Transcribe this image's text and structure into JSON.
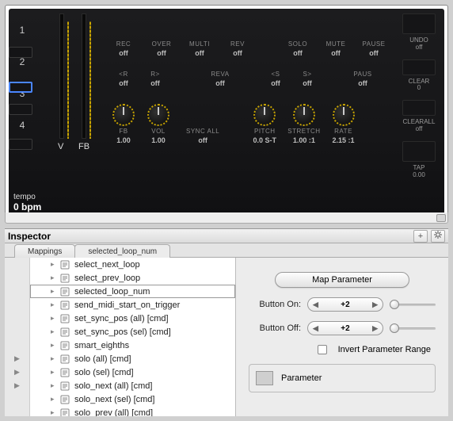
{
  "device": {
    "slots": [
      "1",
      "2",
      "3",
      "4"
    ],
    "selected_slot_index": 1,
    "meters": {
      "v": "V",
      "fb": "FB"
    },
    "row1": [
      {
        "name": "REC",
        "val": "off"
      },
      {
        "name": "OVER",
        "val": "off"
      },
      {
        "name": "MULTI",
        "val": "off"
      },
      {
        "name": "REV",
        "val": "off"
      },
      {
        "name": "SOLO",
        "val": "off"
      },
      {
        "name": "MUTE",
        "val": "off"
      },
      {
        "name": "PAUSE",
        "val": "off"
      }
    ],
    "row2": [
      {
        "name": "<R",
        "val": "off"
      },
      {
        "name": "R>",
        "val": "off"
      },
      {
        "name": "REVA",
        "val": "off"
      },
      {
        "name": "<S",
        "val": "off"
      },
      {
        "name": "S>",
        "val": "off"
      },
      {
        "name": "PAUS",
        "val": "off"
      }
    ],
    "knobs": [
      {
        "name": "FB",
        "val": "1.00"
      },
      {
        "name": "VOL",
        "val": "1.00"
      }
    ],
    "sync": {
      "name": "SYNC ALL",
      "val": "off"
    },
    "knobs2": [
      {
        "name": "PITCH",
        "val": "0.0 S-T"
      },
      {
        "name": "STRETCH",
        "val": "1.00 :1"
      },
      {
        "name": "RATE",
        "val": "2.15 :1"
      }
    ],
    "right": [
      {
        "name": "",
        "val": ""
      },
      {
        "name": "UNDO",
        "val": "off"
      },
      {
        "name": "CLEAR",
        "val": "0"
      },
      {
        "name": "CLEARALL",
        "val": "off"
      },
      {
        "name": "TAP",
        "val": "0.00"
      }
    ],
    "tempo_label": "tempo",
    "tempo_value": "0 bpm"
  },
  "inspector": {
    "title": "Inspector",
    "add_icon": "+",
    "gear_icon": "*",
    "tabs": [
      {
        "label": "Mappings",
        "active": false
      },
      {
        "label": "selected_loop_num",
        "active": true
      }
    ],
    "items": [
      {
        "label": "select_next_loop",
        "sel": false,
        "expand": false
      },
      {
        "label": "select_prev_loop",
        "sel": false,
        "expand": false
      },
      {
        "label": "selected_loop_num",
        "sel": true,
        "expand": false
      },
      {
        "label": "send_midi_start_on_trigger",
        "sel": false,
        "expand": false
      },
      {
        "label": "set_sync_pos (all) [cmd]",
        "sel": false,
        "expand": false
      },
      {
        "label": "set_sync_pos (sel) [cmd]",
        "sel": false,
        "expand": false
      },
      {
        "label": "smart_eighths",
        "sel": false,
        "expand": false
      },
      {
        "label": "solo (all) [cmd]",
        "sel": false,
        "expand": true
      },
      {
        "label": "solo (sel) [cmd]",
        "sel": false,
        "expand": true
      },
      {
        "label": "solo_next (all) [cmd]",
        "sel": false,
        "expand": true
      },
      {
        "label": "solo_next (sel) [cmd]",
        "sel": false,
        "expand": false
      },
      {
        "label": "solo_prev (all) [cmd]",
        "sel": false,
        "expand": false
      }
    ],
    "panel": {
      "map_btn": "Map Parameter",
      "button_on_label": "Button On:",
      "button_on_value": "+2",
      "button_off_label": "Button Off:",
      "button_off_value": "+2",
      "invert_label": "Invert Parameter Range",
      "param_label": "Parameter"
    }
  }
}
